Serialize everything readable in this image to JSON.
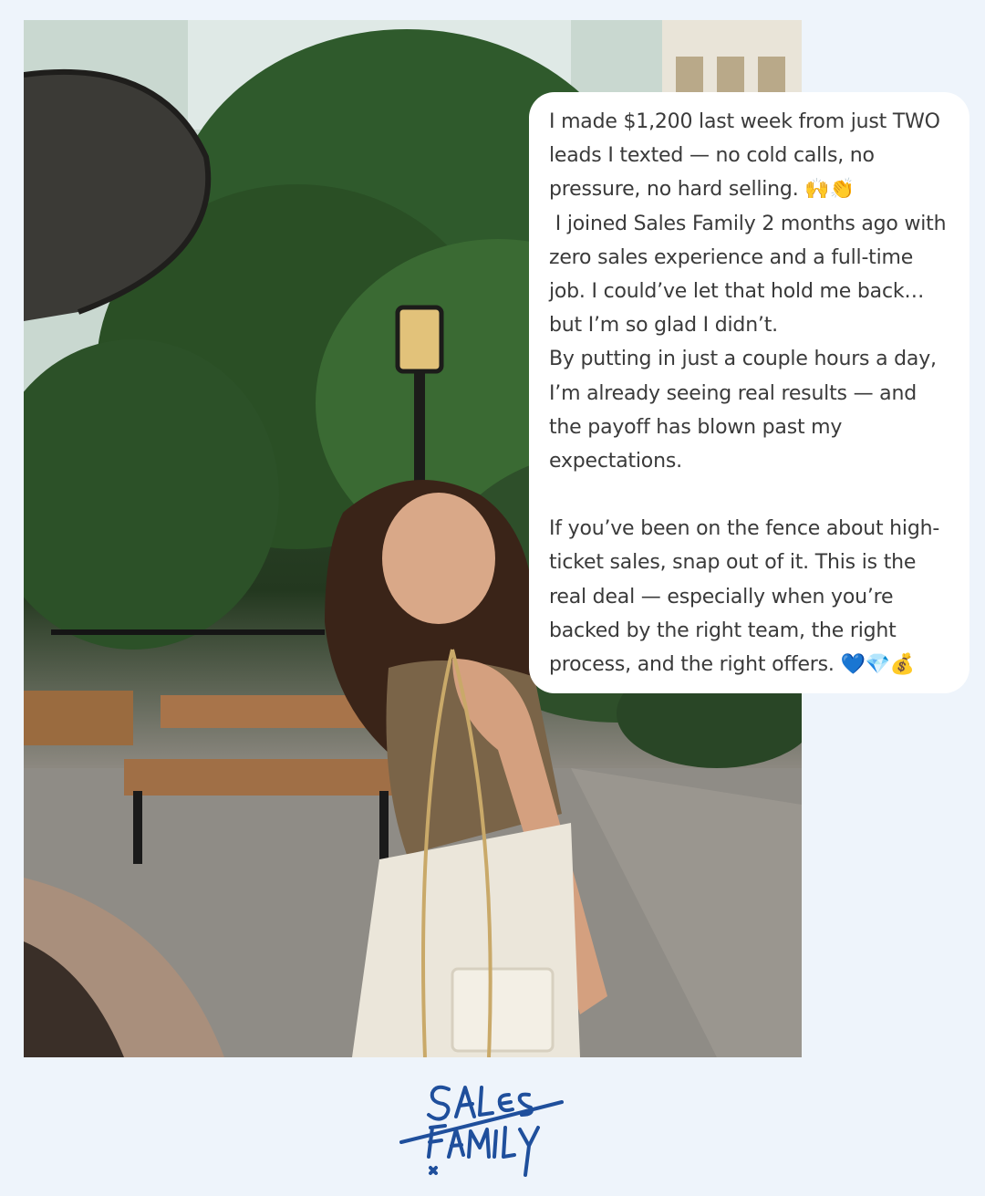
{
  "post": {
    "paragraph1": "I made $1,200 last week from just TWO leads I texted — no cold calls, no pressure, no hard selling. 🙌👏",
    "paragraph2": " I joined Sales Family 2 months ago with zero sales experience and a full-time job. I could’ve let that hold me back… but I’m so glad I didn’t.",
    "paragraph3": "By putting in just a couple hours a day, I’m already seeing real results — and the payoff has blown past my expectations.",
    "paragraph4": "If you’ve been on the fence about high-ticket sales, snap out of it. This is the real deal — especially when you’re backed by the right team, the right process, and the right offers. 💙💎💰"
  },
  "brand": {
    "logo_text": "Sales Family",
    "logo_color": "#1f4f9c",
    "background": "#eef4fb"
  }
}
